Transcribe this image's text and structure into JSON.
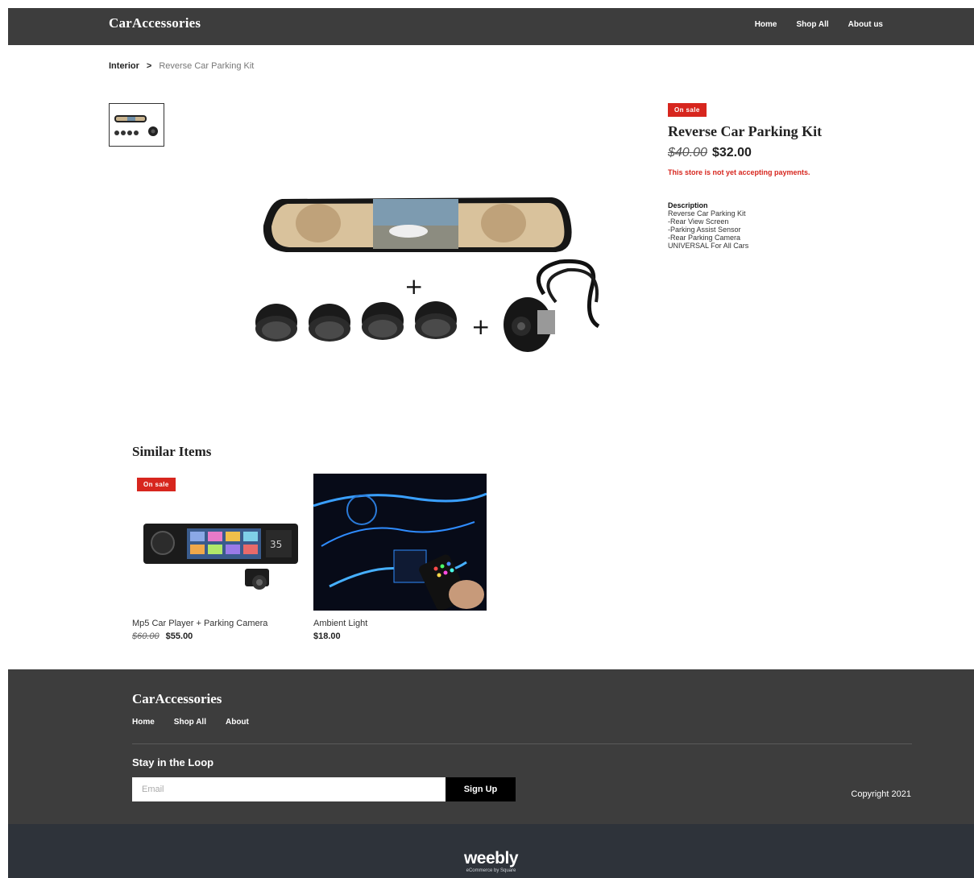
{
  "header": {
    "brand": "CarAccessories",
    "nav": [
      "Home",
      "Shop All",
      "About us"
    ]
  },
  "breadcrumb": {
    "category": "Interior",
    "separator": ">",
    "current": "Reverse Car Parking Kit"
  },
  "product": {
    "badge": "On sale",
    "title": "Reverse Car Parking Kit",
    "price_old": "$40.00",
    "price_new": "$32.00",
    "store_notice": "This store is not yet accepting payments.",
    "description_heading": "Description",
    "description_lines": [
      "Reverse Car Parking Kit",
      "-Rear View Screen",
      "-Parking Assist Sensor",
      "-Rear Parking Camera",
      "UNIVERSAL For All Cars"
    ]
  },
  "similar": {
    "title": "Similar Items",
    "items": [
      {
        "badge": "On sale",
        "name": "Mp5 Car Player + Parking Camera",
        "price_old": "$60.00",
        "price_new": "$55.00"
      },
      {
        "badge": "",
        "name": "Ambient Light",
        "price_old": "",
        "price_new": "$18.00"
      }
    ]
  },
  "footer": {
    "brand": "CarAccessories",
    "nav": [
      "Home",
      "Shop All",
      "About"
    ],
    "newsletter_title": "Stay in the Loop",
    "email_placeholder": "Email",
    "signup_label": "Sign Up",
    "copyright": "Copyright 2021"
  },
  "weebly": {
    "logo": "weebly",
    "sub": "eCommerce by Square"
  },
  "colors": {
    "header_bg": "#3d3d3d",
    "accent_red": "#d7261e",
    "weebly_bar": "#2e333a"
  }
}
